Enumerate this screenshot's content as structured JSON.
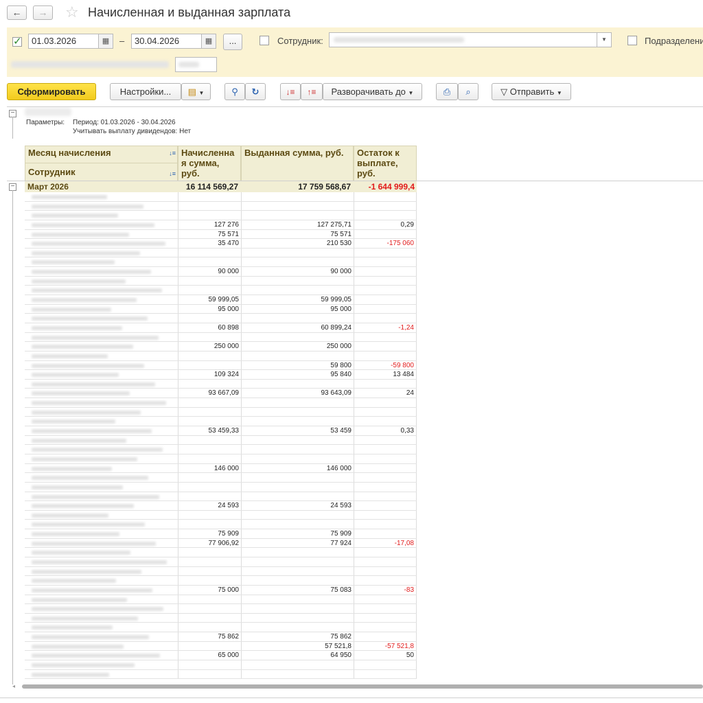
{
  "window": {
    "title": "Начисленная и выданная зарплата",
    "back_icon": "←",
    "forward_icon": "→"
  },
  "filter": {
    "date_from": "01.03.2026",
    "date_dash": "–",
    "date_to": "30.04.2026",
    "ellipsis": "...",
    "employee_label": "Сотрудник:",
    "department_label": "Подразделени"
  },
  "toolbar": {
    "generate": "Сформировать",
    "settings": "Настройки...",
    "expand_to": "Разворачивать до",
    "send": "Отправить"
  },
  "report": {
    "params_label": "Параметры:",
    "param_period": "Период: 01.03.2026 - 30.04.2026",
    "param_dividends": "Учитывать выплату дивидендов: Нет",
    "headers": {
      "month": "Месяц начисления",
      "employee": "Сотрудник",
      "accrued": "Начисленна я сумма, руб.",
      "paid": "Выданная сумма, руб.",
      "remainder": "Остаток к выплате, руб."
    },
    "group": {
      "name": "Март 2026",
      "accrued": "16 114 569,27",
      "paid": "17 759 568,67",
      "remainder": "-1 644 999,4"
    },
    "rows": [
      {
        "a": "",
        "p": "",
        "r": ""
      },
      {
        "a": "",
        "p": "",
        "r": ""
      },
      {
        "a": "",
        "p": "",
        "r": ""
      },
      {
        "a": "127 276",
        "p": "127 275,71",
        "r": "0,29"
      },
      {
        "a": "75 571",
        "p": "75 571",
        "r": ""
      },
      {
        "a": "35 470",
        "p": "210 530",
        "r": "-175 060"
      },
      {
        "a": "",
        "p": "",
        "r": ""
      },
      {
        "a": "",
        "p": "",
        "r": ""
      },
      {
        "a": "90 000",
        "p": "90 000",
        "r": ""
      },
      {
        "a": "",
        "p": "",
        "r": ""
      },
      {
        "a": "",
        "p": "",
        "r": ""
      },
      {
        "a": "59 999,05",
        "p": "59 999,05",
        "r": ""
      },
      {
        "a": "95 000",
        "p": "95 000",
        "r": ""
      },
      {
        "a": "",
        "p": "",
        "r": ""
      },
      {
        "a": "60 898",
        "p": "60 899,24",
        "r": "-1,24"
      },
      {
        "a": "",
        "p": "",
        "r": ""
      },
      {
        "a": "250 000",
        "p": "250 000",
        "r": ""
      },
      {
        "a": "",
        "p": "",
        "r": ""
      },
      {
        "a": "",
        "p": "59 800",
        "r": "-59 800"
      },
      {
        "a": "109 324",
        "p": "95 840",
        "r": "13 484"
      },
      {
        "a": "",
        "p": "",
        "r": ""
      },
      {
        "a": "93 667,09",
        "p": "93 643,09",
        "r": "24"
      },
      {
        "a": "",
        "p": "",
        "r": ""
      },
      {
        "a": "",
        "p": "",
        "r": ""
      },
      {
        "a": "",
        "p": "",
        "r": ""
      },
      {
        "a": "53 459,33",
        "p": "53 459",
        "r": "0,33"
      },
      {
        "a": "",
        "p": "",
        "r": ""
      },
      {
        "a": "",
        "p": "",
        "r": ""
      },
      {
        "a": "",
        "p": "",
        "r": ""
      },
      {
        "a": "146 000",
        "p": "146 000",
        "r": ""
      },
      {
        "a": "",
        "p": "",
        "r": ""
      },
      {
        "a": "",
        "p": "",
        "r": ""
      },
      {
        "a": "",
        "p": "",
        "r": ""
      },
      {
        "a": "24 593",
        "p": "24 593",
        "r": ""
      },
      {
        "a": "",
        "p": "",
        "r": ""
      },
      {
        "a": "",
        "p": "",
        "r": ""
      },
      {
        "a": "75 909",
        "p": "75 909",
        "r": ""
      },
      {
        "a": "77 906,92",
        "p": "77 924",
        "r": "-17,08"
      },
      {
        "a": "",
        "p": "",
        "r": ""
      },
      {
        "a": "",
        "p": "",
        "r": ""
      },
      {
        "a": "",
        "p": "",
        "r": ""
      },
      {
        "a": "",
        "p": "",
        "r": ""
      },
      {
        "a": "75 000",
        "p": "75 083",
        "r": "-83"
      },
      {
        "a": "",
        "p": "",
        "r": ""
      },
      {
        "a": "",
        "p": "",
        "r": ""
      },
      {
        "a": "",
        "p": "",
        "r": ""
      },
      {
        "a": "",
        "p": "",
        "r": ""
      },
      {
        "a": "75 862",
        "p": "75 862",
        "r": ""
      },
      {
        "a": "",
        "p": "57 521,8",
        "r": "-57 521,8"
      },
      {
        "a": "65 000",
        "p": "64 950",
        "r": "50"
      },
      {
        "a": "",
        "p": "",
        "r": ""
      },
      {
        "a": "",
        "p": "",
        "r": ""
      }
    ]
  }
}
